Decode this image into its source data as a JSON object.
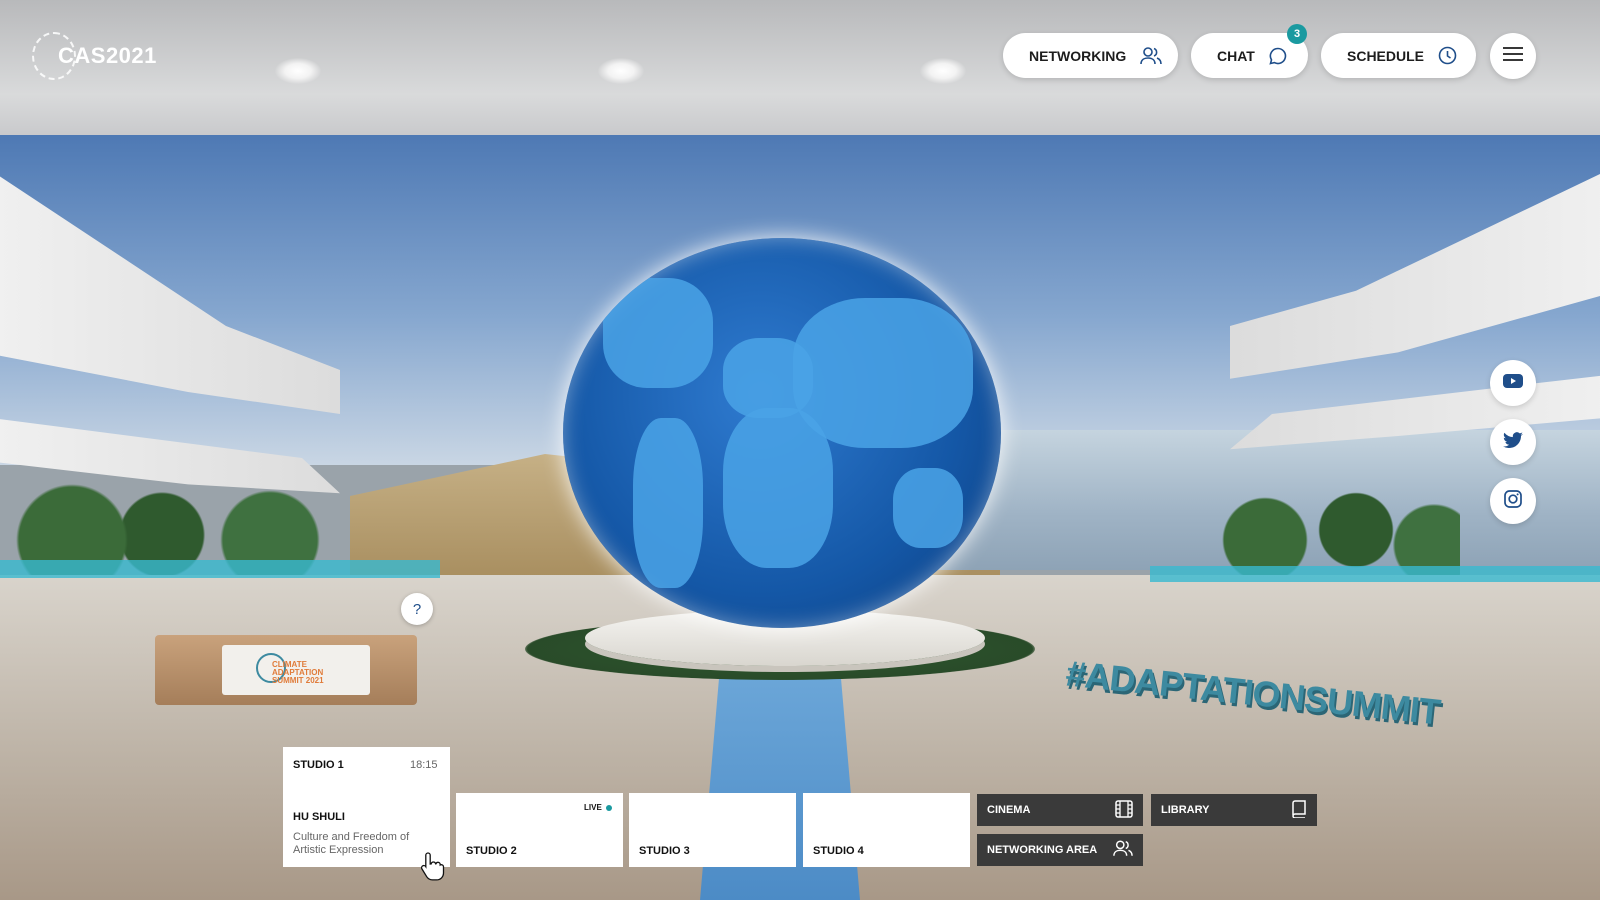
{
  "app": {
    "logo_text": "CAS2021"
  },
  "nav": {
    "networking_label": "NETWORKING",
    "chat_label": "CHAT",
    "chat_badge": "3",
    "schedule_label": "SCHEDULE",
    "menu_icon": "hamburger-menu-icon"
  },
  "social": [
    {
      "name": "youtube",
      "icon": "youtube-icon"
    },
    {
      "name": "twitter",
      "icon": "twitter-icon"
    },
    {
      "name": "instagram",
      "icon": "instagram-icon"
    }
  ],
  "help": {
    "label": "?"
  },
  "scene": {
    "hashtag": "#ADAPTATIONSUMMIT",
    "desk_sign": "CLIMATE ADAPTATION SUMMIT 2021"
  },
  "studios": [
    {
      "title": "STUDIO 1",
      "time": "18:15",
      "speaker": "HU SHULI",
      "session": "Culture and Freedom of Artistic Expression"
    },
    {
      "title": "STUDIO 2",
      "live_label": "LIVE"
    },
    {
      "title": "STUDIO 3"
    },
    {
      "title": "STUDIO 4"
    }
  ],
  "areas": {
    "cinema_label": "CINEMA",
    "library_label": "LIBRARY",
    "networking_area_label": "NETWORKING AREA"
  },
  "colors": {
    "accent": "#1a9aa0",
    "dark_button": "#3a3a3a"
  }
}
